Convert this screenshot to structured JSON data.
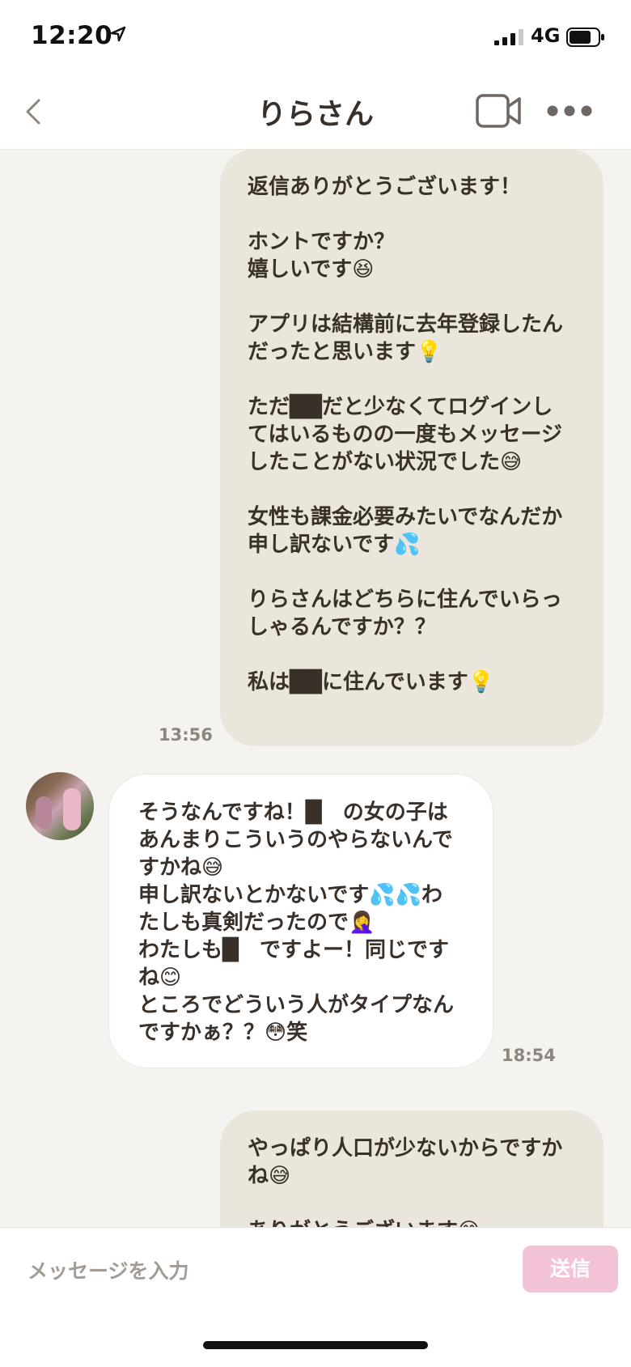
{
  "status_bar": {
    "time": "12:20",
    "network": "4G"
  },
  "header": {
    "title": "りらさん"
  },
  "messages": [
    {
      "side": "out",
      "time": "13:56",
      "lines": [
        "返信ありがとうございます！",
        "",
        "ホントですか？",
        "嬉しいです😆",
        "",
        "アプリは結構前に去年登録したん",
        "だったと思います💡",
        "",
        "ただ██だと少なくてログインし",
        "てはいるものの一度もメッセージ",
        "したことがない状況でした😅",
        "",
        "女性も課金必要みたいでなんだか",
        "申し訳ないです💦",
        "",
        "りらさんはどちらに住んでいらっ",
        "しゃるんですか？？",
        "",
        "私は██に住んでいます💡"
      ]
    },
    {
      "side": "in",
      "time": "18:54",
      "lines": [
        "そうなんですね！█　の女の子は",
        "あんまりこういうのやらないんで",
        "すかね😅",
        "申し訳ないとかないです💦💦わ",
        "たしも真剣だったので🤦‍♀️",
        "わたしも█　ですよー！同じです",
        "ね😊",
        "ところでどういう人がタイプなん",
        "ですかぁ？？😳笑"
      ]
    },
    {
      "side": "out",
      "lines": [
        "やっぱり人口が少ないからですか",
        "ね😅",
        "",
        "ありがとうございます😊"
      ]
    }
  ],
  "input": {
    "placeholder": "メッセージを入力",
    "send_label": "送信"
  },
  "colors": {
    "outgoing_bubble": "#ebe6dc",
    "incoming_bubble": "#ffffff",
    "send_button": "#f2c3d7",
    "background": "#f4f3ef"
  }
}
